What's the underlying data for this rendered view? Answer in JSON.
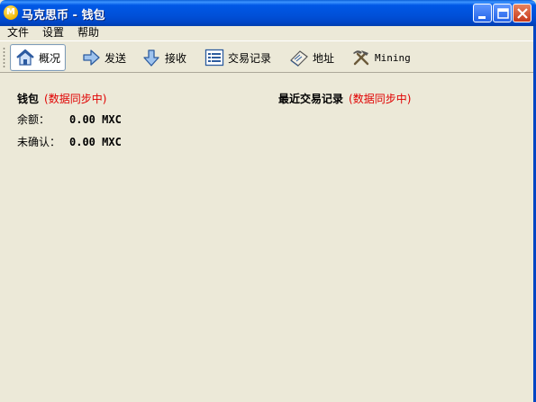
{
  "window": {
    "title": "马克思币 - 钱包",
    "app_icon_letter": "M"
  },
  "menu": {
    "items": [
      "文件",
      "设置",
      "帮助"
    ]
  },
  "toolbar": {
    "buttons": [
      {
        "label": "概况",
        "icon": "home-icon",
        "active": true
      },
      {
        "label": "发送",
        "icon": "arrow-right-icon"
      },
      {
        "label": "接收",
        "icon": "arrow-down-icon"
      },
      {
        "label": "交易记录",
        "icon": "list-icon"
      },
      {
        "label": "地址",
        "icon": "address-book-icon"
      },
      {
        "label": "Mining",
        "icon": "hammer-pick-icon"
      }
    ]
  },
  "wallet": {
    "title": "钱包",
    "sync_status": "(数据同步中)",
    "balance_label": "余额：",
    "balance_value": "0.00 MXC",
    "unconfirmed_label": "未确认：",
    "unconfirmed_value": "0.00 MXC"
  },
  "recent": {
    "title": "最近交易记录",
    "sync_status": "(数据同步中)"
  },
  "colors": {
    "titlebar": "#0050d8",
    "sync_red": "#e00000",
    "background": "#ece9d8"
  }
}
